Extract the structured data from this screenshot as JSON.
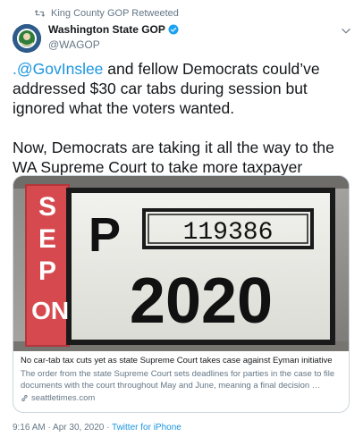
{
  "retweet": {
    "icon": "retweet-icon",
    "label": "King County GOP Retweeted"
  },
  "author": {
    "name": "Washington State GOP",
    "handle": "@WAGOP",
    "verified_icon": "verified-badge-icon"
  },
  "tweet": {
    "mention": ".@GovInslee",
    "paragraph1_rest": " and fellow Democrats could’ve addressed $30 car tabs during session but ignored what the voters wanted.",
    "paragraph2": "Now, Democrats are taking it all the way to the WA Supreme Court to take more taxpayer money."
  },
  "card": {
    "image": {
      "sticker_letters": [
        "S",
        "E",
        "P",
        "O",
        "N"
      ],
      "plate_letter": "P",
      "plate_number": "119386",
      "plate_year": "2020"
    },
    "title": "No car-tab tax cuts yet as state Supreme Court takes case against Eyman initiative",
    "description": "The order from the state Supreme Court sets deadlines for parties in the case to file documents with the court throughout May and June, meaning a final decision …",
    "domain_icon": "link-icon",
    "domain": "seattletimes.com"
  },
  "meta": {
    "time": "9:16 AM",
    "separator": " · ",
    "date": "Apr 30, 2020",
    "source": "Twitter for iPhone"
  },
  "colors": {
    "link": "#1b95e0",
    "secondary_text": "#657786",
    "sticker_red": "#d64a4f",
    "verified": "#1da1f2"
  }
}
